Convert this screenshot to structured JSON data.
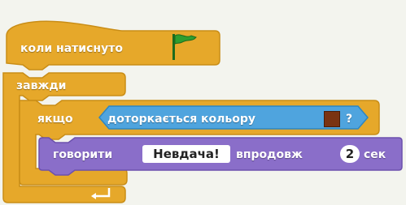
{
  "blocks": {
    "when_flag": {
      "label": "коли натиснуто",
      "icon": "green-flag-icon"
    },
    "forever": {
      "label": "завжди"
    },
    "if_block": {
      "label": "якщо"
    },
    "touching_color": {
      "label": "доторкається кольору",
      "color": "#7a3312",
      "suffix": "?"
    },
    "say_for": {
      "label": "говорити",
      "message": "Невдача!",
      "for_label": "впродовж",
      "seconds": "2",
      "unit_label": "сек"
    }
  },
  "colors": {
    "control": "#e6a82a",
    "control_dark": "#c98d16",
    "sensing": "#4fa4de",
    "looks": "#8a6ec9",
    "flag_green": "#2f9e2f"
  }
}
